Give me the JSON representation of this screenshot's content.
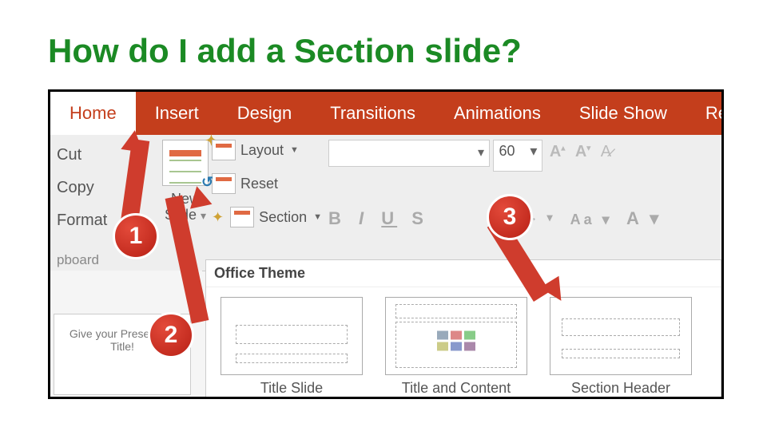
{
  "page": {
    "title": "How do I add a Section slide?"
  },
  "ribbon": {
    "tabs": {
      "home": "Home",
      "insert": "Insert",
      "design": "Design",
      "transitions": "Transitions",
      "animations": "Animations",
      "slideshow": "Slide Show",
      "review_cut": "Re"
    },
    "clipboard": {
      "cut": "Cut",
      "copy": "Copy",
      "format": "Format     ter",
      "group": "pboard"
    },
    "newslide": {
      "line1": "New",
      "line2": "Slide",
      "dropdown": "▾"
    },
    "slideopts": {
      "layout": "Layout",
      "reset": "Reset",
      "section": "Section"
    },
    "font": {
      "size": "60"
    }
  },
  "gallery": {
    "heading": "Office Theme",
    "thumb1": "Title Slide",
    "thumb2": "Title and Content",
    "thumb3": "Section Header"
  },
  "minislide": {
    "line1": "Give your Prese",
    "line2": "Title!",
    "line3": "a"
  },
  "callouts": {
    "c1": "1",
    "c2": "2",
    "c3": "3"
  }
}
